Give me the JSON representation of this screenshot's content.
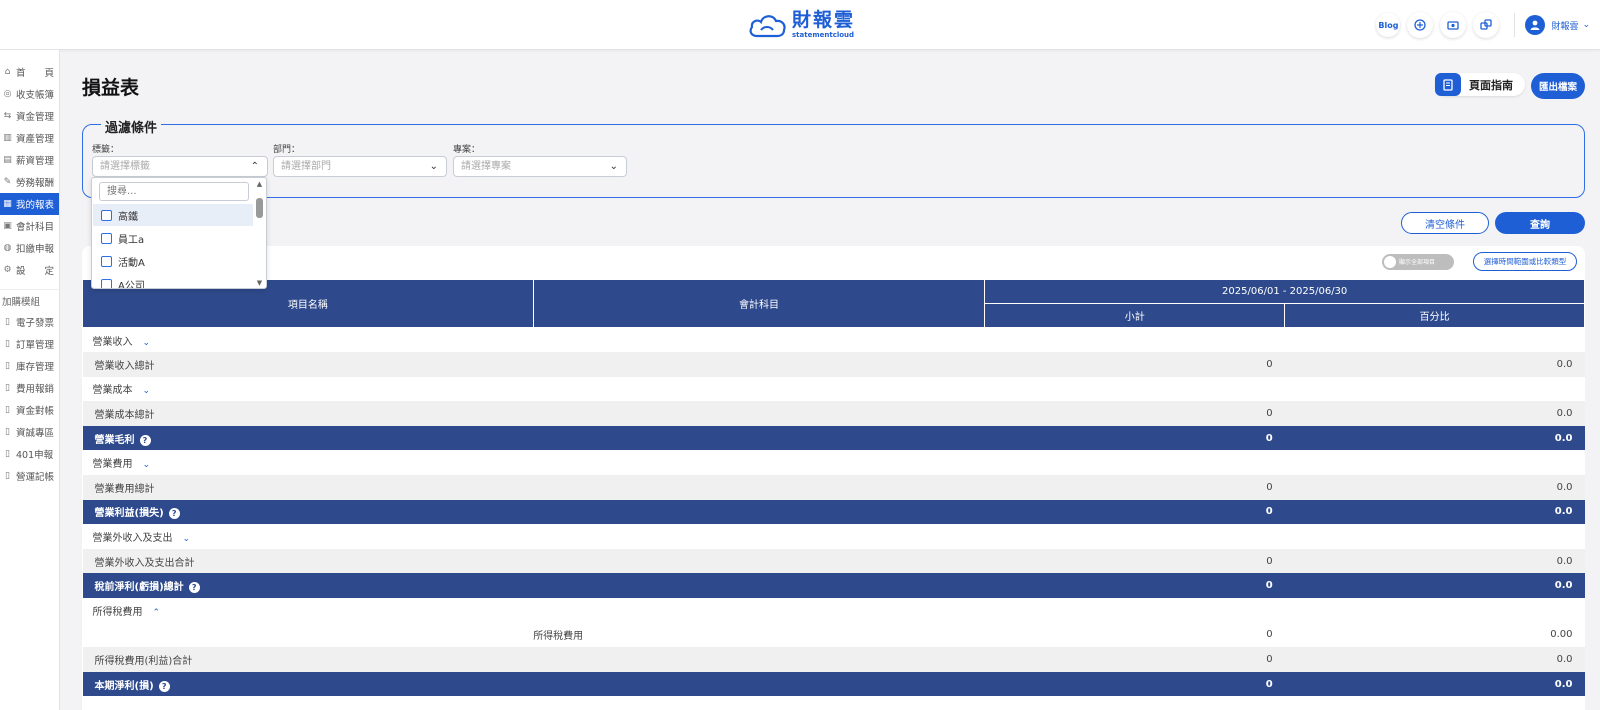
{
  "header": {
    "logo_cn": "財報雲",
    "logo_en": "statementcloud",
    "blog_label": "Blog",
    "user_name": "財報雲"
  },
  "sidebar": {
    "items": [
      {
        "label": "首　　頁",
        "icon": "home-icon"
      },
      {
        "label": "收支帳簿",
        "icon": "ledger-icon"
      },
      {
        "label": "資金管理",
        "icon": "funds-icon"
      },
      {
        "label": "資產管理",
        "icon": "assets-icon"
      },
      {
        "label": "薪資管理",
        "icon": "payroll-icon"
      },
      {
        "label": "勞務報酬",
        "icon": "labor-icon"
      },
      {
        "label": "我的報表",
        "icon": "report-icon",
        "active": true
      },
      {
        "label": "會計科目",
        "icon": "accounts-icon"
      },
      {
        "label": "扣繳申報",
        "icon": "tax-icon"
      },
      {
        "label": "設　　定",
        "icon": "settings-icon"
      }
    ],
    "group_label": "加購模組",
    "addons": [
      "電子發票",
      "訂單管理",
      "庫存管理",
      "費用報銷",
      "資金對帳",
      "資誠專區",
      "401申報",
      "營運記帳"
    ]
  },
  "page": {
    "title": "損益表",
    "guide_label": "頁面指南",
    "export_label": "匯出檔案"
  },
  "filter": {
    "legend": "過濾條件",
    "tag_label": "標籤：",
    "tag_placeholder": "請選擇標籤",
    "dept_label": "部門：",
    "dept_placeholder": "請選擇部門",
    "project_label": "專案：",
    "project_placeholder": "請選擇專案",
    "dropdown": {
      "search_placeholder": "搜尋...",
      "options": [
        "高鐵",
        "員工a",
        "活動A",
        "A公司"
      ]
    },
    "clear_label": "清空條件",
    "query_label": "查詢"
  },
  "report": {
    "toggle_label": "顯示全部項目",
    "range_label": "選擇時間範圍或比較類型",
    "columns": {
      "item": "項目名稱",
      "account": "會計科目",
      "period": "2025/06/01 - 2025/06/30",
      "subtotal": "小計",
      "percent": "百分比"
    },
    "rows": [
      {
        "type": "sec",
        "name": "營業收入",
        "chevron": "⌄"
      },
      {
        "type": "sub",
        "name": "營業收入總計",
        "subtotal": "0",
        "percent": "0.0"
      },
      {
        "type": "sec",
        "name": "營業成本",
        "chevron": "⌄"
      },
      {
        "type": "sub",
        "name": "營業成本總計",
        "subtotal": "0",
        "percent": "0.0"
      },
      {
        "type": "tot",
        "name": "營業毛利",
        "subtotal": "0",
        "percent": "0.0",
        "help": "?"
      },
      {
        "type": "sec",
        "name": "營業費用",
        "chevron": "⌄"
      },
      {
        "type": "sub",
        "name": "營業費用總計",
        "subtotal": "0",
        "percent": "0.0"
      },
      {
        "type": "tot",
        "name": "營業利益(損失)",
        "subtotal": "0",
        "percent": "0.0",
        "help": "?"
      },
      {
        "type": "sec",
        "name": "營業外收入及支出",
        "chevron": "⌄"
      },
      {
        "type": "sub",
        "name": "營業外收入及支出合計",
        "subtotal": "0",
        "percent": "0.0"
      },
      {
        "type": "tot",
        "name": "稅前淨利(虧損)總計",
        "subtotal": "0",
        "percent": "0.0",
        "help": "?"
      },
      {
        "type": "sec",
        "name": "所得稅費用",
        "chevron": "⌃"
      },
      {
        "type": "detail",
        "name": "",
        "account": "所得稅費用",
        "subtotal": "0",
        "percent": "0.00"
      },
      {
        "type": "sub",
        "name": "所得稅費用(利益)合計",
        "subtotal": "0",
        "percent": "0.0"
      },
      {
        "type": "tot",
        "name": "本期淨利(損)",
        "subtotal": "0",
        "percent": "0.0",
        "help": "?"
      }
    ]
  },
  "colors": {
    "accent": "#1f5fd6",
    "table_header": "#2e4a8c"
  }
}
